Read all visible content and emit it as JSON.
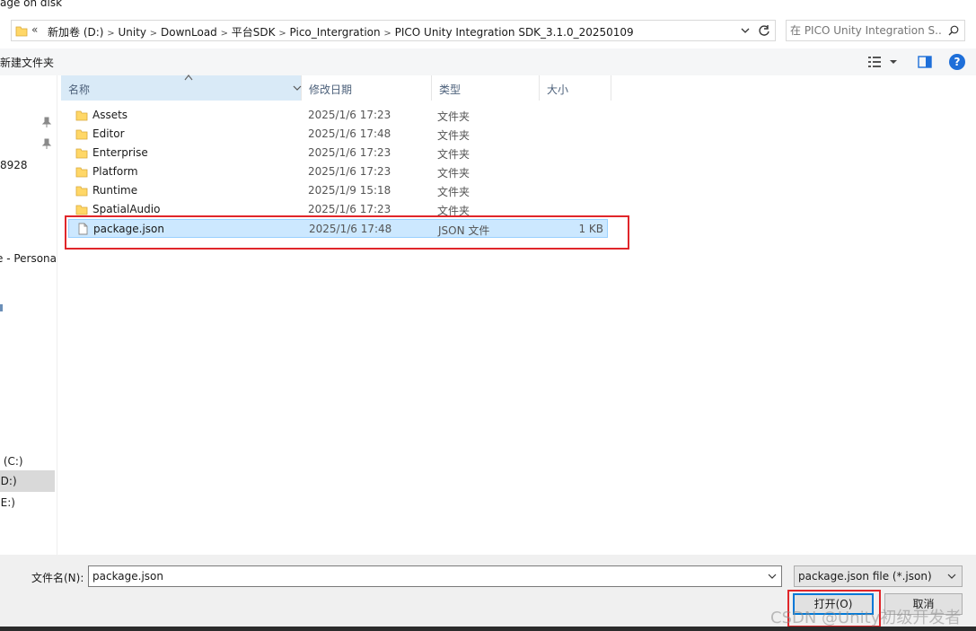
{
  "window": {
    "title": "age on disk"
  },
  "address": {
    "overflow": "«",
    "crumbs": [
      "新加卷 (D:)",
      "Unity",
      "DownLoad",
      "平台SDK",
      "Pico_Intergration",
      "PICO Unity Integration SDK_3.1.0_20250109"
    ]
  },
  "search": {
    "placeholder": "在 PICO Unity Integration S..."
  },
  "toolbar": {
    "new_folder": "新建文件夹"
  },
  "nav": {
    "items": [
      "8928",
      "e - Persona",
      "盘 (C:)",
      "(D:)",
      "(E:)"
    ]
  },
  "columns": {
    "name": "名称",
    "modified": "修改日期",
    "type": "类型",
    "size": "大小"
  },
  "files": [
    {
      "name": "Assets",
      "date": "2025/1/6 17:23",
      "type": "文件夹",
      "size": "",
      "icon": "folder-icon"
    },
    {
      "name": "Editor",
      "date": "2025/1/6 17:48",
      "type": "文件夹",
      "size": "",
      "icon": "folder-icon"
    },
    {
      "name": "Enterprise",
      "date": "2025/1/6 17:23",
      "type": "文件夹",
      "size": "",
      "icon": "folder-icon"
    },
    {
      "name": "Platform",
      "date": "2025/1/6 17:23",
      "type": "文件夹",
      "size": "",
      "icon": "folder-icon"
    },
    {
      "name": "Runtime",
      "date": "2025/1/9 15:18",
      "type": "文件夹",
      "size": "",
      "icon": "folder-icon"
    },
    {
      "name": "SpatialAudio",
      "date": "2025/1/6 17:23",
      "type": "文件夹",
      "size": "",
      "icon": "folder-icon"
    },
    {
      "name": "package.json",
      "date": "2025/1/6 17:48",
      "type": "JSON 文件",
      "size": "1 KB",
      "icon": "file-icon"
    }
  ],
  "footer": {
    "filename_label": "文件名(N):",
    "filename_value": "package.json",
    "filter": "package.json file (*.json)",
    "open": "打开(O)",
    "cancel": "取消"
  },
  "watermark": "CSDN @Unity初级开发者",
  "colors": {
    "accent": "#0078d7",
    "selection": "#cce8ff",
    "annotation": "#e0262a",
    "folder": "#ffd767"
  }
}
